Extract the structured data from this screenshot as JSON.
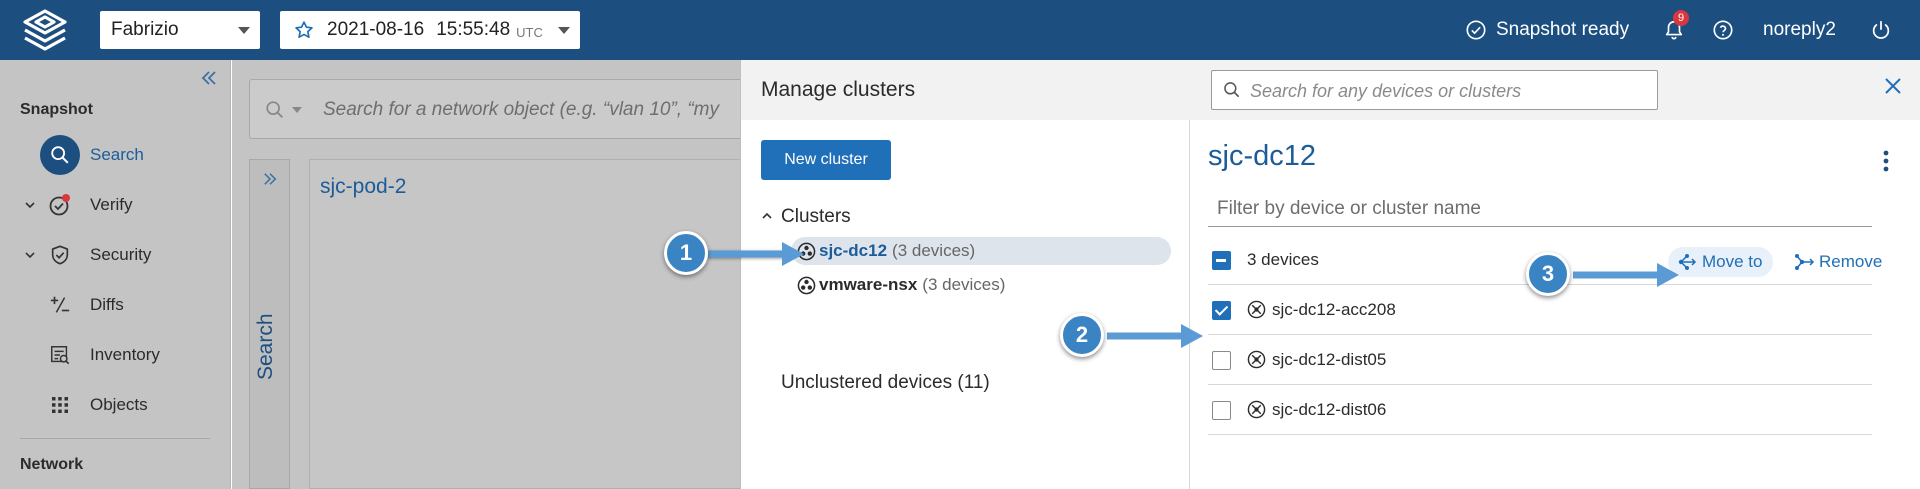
{
  "topbar": {
    "workspace": "Fabrizio",
    "snapshot_date": "2021-08-16",
    "snapshot_time": "15:55:48",
    "snapshot_tz": "UTC",
    "status": "Snapshot ready",
    "notification_count": "9",
    "user": "noreply2"
  },
  "sidebar": {
    "section_snapshot": "Snapshot",
    "items": [
      {
        "label": "Search",
        "icon": "search-icon"
      },
      {
        "label": "Verify",
        "icon": "verify-icon"
      },
      {
        "label": "Security",
        "icon": "shield-icon"
      },
      {
        "label": "Diffs",
        "icon": "diff-icon"
      },
      {
        "label": "Inventory",
        "icon": "inventory-icon"
      },
      {
        "label": "Objects",
        "icon": "grid-icon"
      }
    ],
    "section_network": "Network"
  },
  "main": {
    "search_placeholder": "Search for a network object (e.g. “vlan 10”, “my",
    "vertical_tab": "Search",
    "card_title": "sjc-pod-2"
  },
  "modal": {
    "title": "Manage clusters",
    "search_placeholder": "Search for any devices or clusters",
    "new_cluster_label": "New cluster",
    "tree": {
      "clusters_label": "Clusters",
      "items": [
        {
          "name": "sjc-dc12",
          "count": "(3 devices)",
          "selected": true
        },
        {
          "name": "vmware-nsx",
          "count": "(3 devices)",
          "selected": false
        }
      ],
      "unclustered_label": "Unclustered devices (11)"
    },
    "detail": {
      "title": "sjc-dc12",
      "filter_placeholder": "Filter by device or cluster name",
      "count_label": "3 devices",
      "move_to_label": "Move to",
      "remove_label": "Remove",
      "devices": [
        {
          "name": "sjc-dc12-acc208",
          "checked": true
        },
        {
          "name": "sjc-dc12-dist05",
          "checked": false
        },
        {
          "name": "sjc-dc12-dist06",
          "checked": false
        }
      ]
    }
  },
  "callouts": [
    "1",
    "2",
    "3"
  ],
  "colors": {
    "topbar": "#1c4f80",
    "accent": "#1f6fb9",
    "callout": "#3b84c4",
    "sidebar_bg": "#c4c4c4"
  }
}
